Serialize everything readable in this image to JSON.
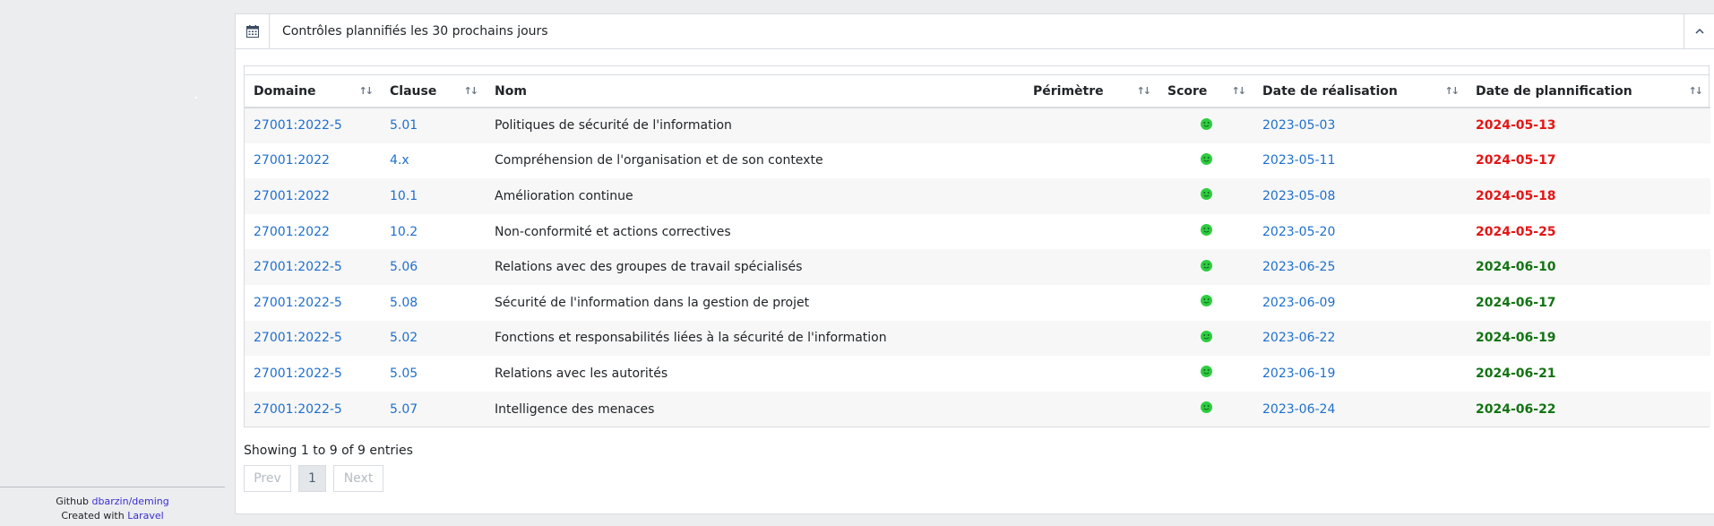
{
  "footer": {
    "github_prefix": "Github",
    "github_link": "dbarzin/deming",
    "created_prefix": "Created with",
    "created_link": "Laravel"
  },
  "card": {
    "title": "Contrôles plannifiés les 30 prochains jours",
    "icon": "calendar-icon",
    "collapse_icon": "chevron-up-icon"
  },
  "table": {
    "columns": [
      "Domaine",
      "Clause",
      "Nom",
      "Périmètre",
      "Score",
      "Date de réalisation",
      "Date de plannification"
    ],
    "rows": [
      {
        "domaine": "27001:2022-5",
        "clause": "5.01",
        "nom": "Politiques de sécurité de l'information",
        "perimetre": "",
        "realisation": "2023-05-03",
        "plannification": "2024-05-13",
        "status": "late"
      },
      {
        "domaine": "27001:2022",
        "clause": "4.x",
        "nom": "Compréhension de l'organisation et de son contexte",
        "perimetre": "",
        "realisation": "2023-05-11",
        "plannification": "2024-05-17",
        "status": "late"
      },
      {
        "domaine": "27001:2022",
        "clause": "10.1",
        "nom": "Amélioration continue",
        "perimetre": "",
        "realisation": "2023-05-08",
        "plannification": "2024-05-18",
        "status": "late"
      },
      {
        "domaine": "27001:2022",
        "clause": "10.2",
        "nom": "Non-conformité et actions correctives",
        "perimetre": "",
        "realisation": "2023-05-20",
        "plannification": "2024-05-25",
        "status": "late"
      },
      {
        "domaine": "27001:2022-5",
        "clause": "5.06",
        "nom": "Relations avec des groupes de travail spécialisés",
        "perimetre": "",
        "realisation": "2023-06-25",
        "plannification": "2024-06-10",
        "status": "ok"
      },
      {
        "domaine": "27001:2022-5",
        "clause": "5.08",
        "nom": "Sécurité de l'information dans la gestion de projet",
        "perimetre": "",
        "realisation": "2023-06-09",
        "plannification": "2024-06-17",
        "status": "ok"
      },
      {
        "domaine": "27001:2022-5",
        "clause": "5.02",
        "nom": "Fonctions et responsabilités liées à la sécurité de l'information",
        "perimetre": "",
        "realisation": "2023-06-22",
        "plannification": "2024-06-19",
        "status": "ok"
      },
      {
        "domaine": "27001:2022-5",
        "clause": "5.05",
        "nom": "Relations avec les autorités",
        "perimetre": "",
        "realisation": "2023-06-19",
        "plannification": "2024-06-21",
        "status": "ok"
      },
      {
        "domaine": "27001:2022-5",
        "clause": "5.07",
        "nom": "Intelligence des menaces",
        "perimetre": "",
        "realisation": "2023-06-24",
        "plannification": "2024-06-22",
        "status": "ok"
      }
    ],
    "score_icon": "green-smiley-icon"
  },
  "info": "Showing 1 to 9 of 9 entries",
  "pagination": {
    "prev": "Prev",
    "current": "1",
    "next": "Next"
  },
  "colors": {
    "link": "#1f6fcc",
    "late": "#e41515",
    "ok": "#137313",
    "score": "#2ecc40"
  }
}
